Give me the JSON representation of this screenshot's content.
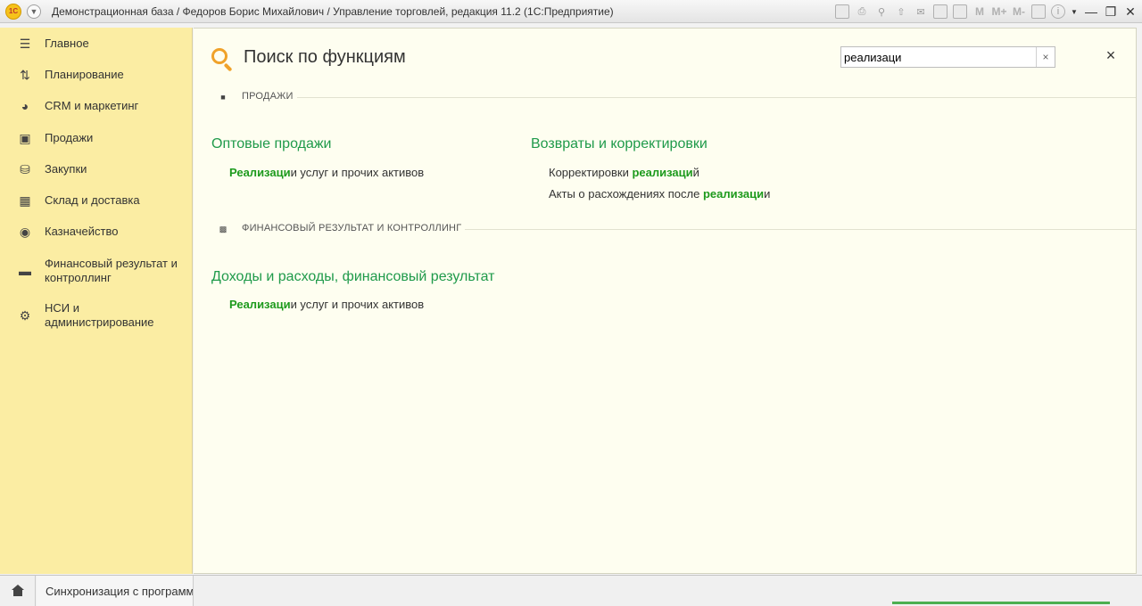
{
  "window": {
    "title": "Демонстрационная база / Федоров Борис Михайлович / Управление торговлей, редакция 11.2  (1С:Предприятие)",
    "logo_text": "1С"
  },
  "sidebar": {
    "items": [
      {
        "label": "Главное",
        "icon": "menu-lines-icon"
      },
      {
        "label": "Планирование",
        "icon": "planning-icon"
      },
      {
        "label": "CRM и маркетинг",
        "icon": "pie-chart-icon"
      },
      {
        "label": "Продажи",
        "icon": "shopping-bag-icon"
      },
      {
        "label": "Закупки",
        "icon": "cart-icon"
      },
      {
        "label": "Склад и доставка",
        "icon": "warehouse-grid-icon"
      },
      {
        "label": "Казначейство",
        "icon": "ruble-coin-icon"
      },
      {
        "label": "Финансовый результат и контроллинг",
        "icon": "bar-chart-icon"
      },
      {
        "label": "НСИ и администрирование",
        "icon": "gear-icon"
      }
    ]
  },
  "main": {
    "title": "Поиск по функциям",
    "search": {
      "value": "реализаци",
      "clear": "×"
    },
    "close": "×",
    "sections": [
      {
        "label": "ПРОДАЖИ",
        "icon": "shopping-bag-icon"
      },
      {
        "label": "ФИНАНСОВЫЙ РЕЗУЛЬТАТ И КОНТРОЛЛИНГ",
        "icon": "bar-chart-icon"
      }
    ],
    "groups": {
      "wholesale": {
        "title": "Оптовые продажи",
        "items": [
          {
            "hl": "Реализаци",
            "rest": "и услуг и прочих активов"
          }
        ]
      },
      "returns": {
        "title": "Возвраты и корректировки",
        "items": [
          {
            "pre": "Корректировки ",
            "hl": "реализаци",
            "rest": "й"
          },
          {
            "pre": "Акты о расхождениях после ",
            "hl": "реализаци",
            "rest": "и"
          }
        ]
      },
      "income": {
        "title": "Доходы и расходы, финансовый результат",
        "items": [
          {
            "hl": "Реализаци",
            "rest": "и услуг и прочих активов"
          }
        ]
      }
    }
  },
  "bottombar": {
    "tab_label": "Синхронизация с программой"
  },
  "colors": {
    "sidebar_bg": "#fbeda3",
    "group_title": "#1f9a4a",
    "highlight": "#1d9a1d",
    "search_icon": "#f0a22a"
  }
}
